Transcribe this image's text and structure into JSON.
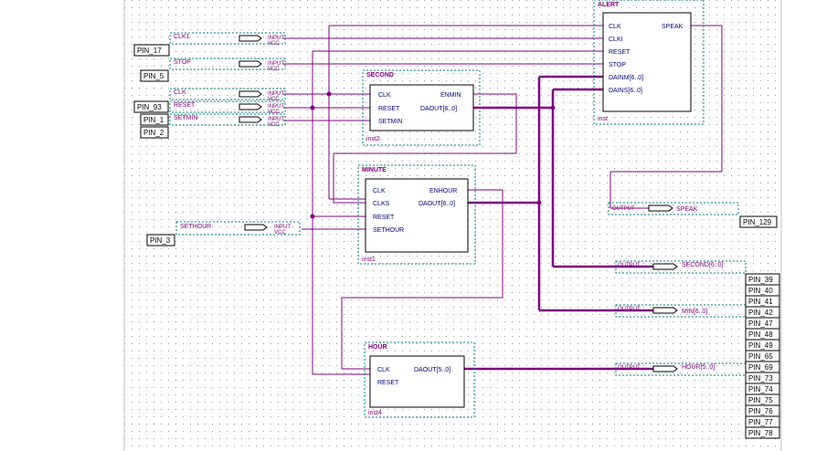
{
  "diagram": {
    "colors": {
      "wire": "#800080",
      "block_border": "#000000",
      "dotted": "#008080",
      "port_text": "#000080",
      "grid": "#9a9a9a"
    },
    "blocks": {
      "alert": {
        "title": "ALERT",
        "inst": "inst",
        "inputs": [
          "CLK",
          "CLKI",
          "RESET",
          "STOP",
          "DAINM[6..0]",
          "DAINS[6..0]"
        ],
        "outputs": [
          "SPEAK"
        ]
      },
      "second": {
        "title": "SECOND",
        "inst": "inst2",
        "inputs": [
          "CLK",
          "RESET",
          "SETMIN"
        ],
        "outputs": [
          "ENMIN",
          "DAOUT[6..0]"
        ]
      },
      "minute": {
        "title": "MINUTE",
        "inst": "inst1",
        "inputs": [
          "CLK",
          "CLKS",
          "RESET",
          "SETHOUR"
        ],
        "outputs": [
          "ENHOUR",
          "DAOUT[6..0]"
        ]
      },
      "hour": {
        "title": "HOUR",
        "inst": "inst4",
        "inputs": [
          "CLK",
          "RESET"
        ],
        "outputs": [
          "DAOUT[5..0]"
        ]
      }
    },
    "inputs": [
      {
        "name": "CLK1",
        "pin": "PIN_17",
        "kind": "INPUT",
        "vcc": "VCC"
      },
      {
        "name": "STOP",
        "pin": "PIN_5",
        "kind": "INPUT",
        "vcc": "VCC"
      },
      {
        "name": "CLK",
        "pin": "",
        "kind": "INPUT",
        "vcc": "VCC"
      },
      {
        "name": "RESET",
        "pin": "PIN_93",
        "kind": "INPUT",
        "vcc": "VCC"
      },
      {
        "name": "SETMIN",
        "pin": "PIN_1",
        "kind": "INPUT",
        "vcc": "VCC"
      },
      {
        "name": "",
        "pin": "PIN_2",
        "kind": "",
        "vcc": ""
      },
      {
        "name": "SETHOUR",
        "pin": "PIN_3",
        "kind": "INPUT",
        "vcc": "VCC"
      }
    ],
    "outputs": [
      {
        "name": "SPEAK",
        "kind": "OUTPUT",
        "pin": "PIN_129"
      },
      {
        "name": "SECOND[6..0]",
        "kind": "OUTPUT"
      },
      {
        "name": "MIN[6..0]",
        "kind": "OUTPUT"
      },
      {
        "name": "HOUR[5..0]",
        "kind": "OUTPUT"
      }
    ],
    "right_pins": [
      "PIN_39",
      "PIN_40",
      "PIN_41",
      "PIN_42",
      "PIN_47",
      "PIN_48",
      "PIN_49",
      "PIN_65",
      "PIN_69",
      "PIN_73",
      "PIN_74",
      "PIN_75",
      "PIN_76",
      "PIN_77",
      "PIN_78"
    ]
  }
}
